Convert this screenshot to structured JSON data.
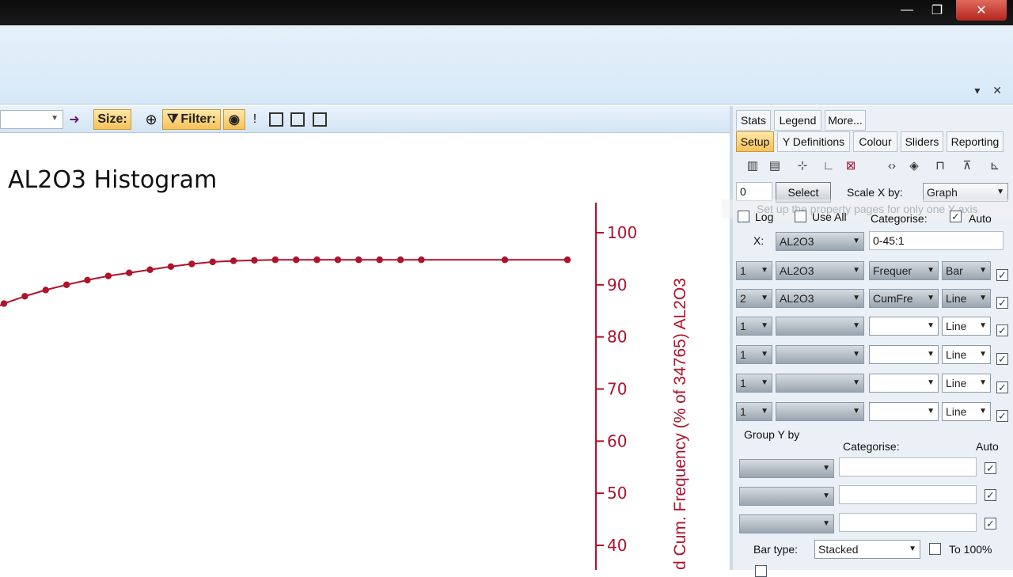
{
  "window": {
    "controls": {
      "minimize": "—",
      "restore": "❐",
      "close": "✕"
    }
  },
  "ribbon": {
    "controls": "▾ ✕"
  },
  "toolbar": {
    "arrow": "➜",
    "size_label": "Size:",
    "filter_label": "Filter:",
    "bang": "!"
  },
  "chart": {
    "title": "AL2O3 Histogram",
    "y2_label": "d Cum. Frequency (% of 34765) AL2O3"
  },
  "chart_data": {
    "type": "line",
    "title": "AL2O3 Histogram",
    "ylabel": "d Cum. Frequency (% of 34765) AL2O3",
    "y_ticks": [
      100,
      90,
      80,
      70,
      60,
      50,
      40
    ],
    "ylim": [
      37,
      102
    ],
    "xlim": [
      0,
      45
    ],
    "series": [
      {
        "color": "#b0122a",
        "x": [
          0,
          1,
          2,
          3,
          4,
          5,
          6,
          7,
          8,
          9,
          10,
          11,
          12,
          13,
          14,
          15,
          16,
          17,
          18,
          19,
          20,
          24,
          27
        ],
        "y": [
          86.4,
          87.8,
          89.0,
          90.0,
          90.9,
          91.7,
          92.3,
          92.9,
          93.5,
          94.0,
          94.4,
          94.6,
          94.7,
          94.8,
          94.8,
          94.8,
          94.8,
          94.8,
          94.8,
          94.8,
          94.8,
          94.8,
          94.8
        ]
      }
    ]
  },
  "panel": {
    "tabs_row1": [
      "Stats",
      "Legend",
      "More..."
    ],
    "tabs_row2": [
      "Setup",
      "Y Definitions",
      "Colour",
      "Sliders",
      "Reporting"
    ],
    "value_field": "0",
    "select_btn": "Select",
    "scale_x_label": "Scale X by:",
    "scale_x_value": "Graph",
    "tooltip": "Set up the property pages for only one Y axis",
    "log_label": "Log",
    "use_all_label": "Use All",
    "categorise_label": "Categorise:",
    "auto_label": "Auto",
    "x_label": "X:",
    "x_field": "AL2O3",
    "x_range": "0-45:1",
    "rows": [
      {
        "axis": "1",
        "field": "AL2O3",
        "stat": "Frequer",
        "type": "Bar"
      },
      {
        "axis": "2",
        "field": "AL2O3",
        "stat": "CumFre",
        "type": "Line"
      },
      {
        "axis": "1",
        "field": "",
        "stat": "",
        "type": "Line"
      },
      {
        "axis": "1",
        "field": "",
        "stat": "",
        "type": "Line"
      },
      {
        "axis": "1",
        "field": "",
        "stat": "",
        "type": "Line"
      },
      {
        "axis": "1",
        "field": "",
        "stat": "",
        "type": "Line"
      }
    ],
    "group_y_label": "Group Y by",
    "categorise2_label": "Categorise:",
    "auto2_label": "Auto",
    "bar_type_label": "Bar type:",
    "bar_type_value": "Stacked",
    "to100_label": "To 100%"
  }
}
